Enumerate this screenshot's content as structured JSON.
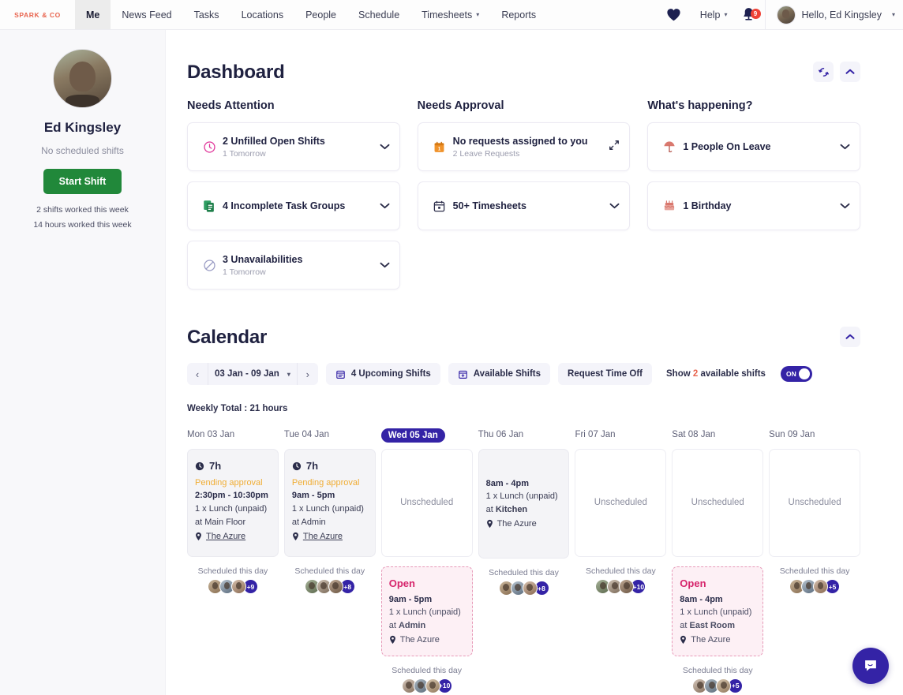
{
  "topnav": {
    "brand": "SPARK & CO",
    "items": [
      {
        "label": "Me",
        "active": true
      },
      {
        "label": "News Feed",
        "active": false
      },
      {
        "label": "Tasks",
        "active": false
      },
      {
        "label": "Locations",
        "active": false
      },
      {
        "label": "People",
        "active": false
      },
      {
        "label": "Schedule",
        "active": false
      },
      {
        "label": "Timesheets",
        "active": false,
        "caret": true
      },
      {
        "label": "Reports",
        "active": false
      }
    ],
    "help_label": "Help",
    "notification_count": "9",
    "user_label": "Hello, Ed Kingsley"
  },
  "sidebar": {
    "name": "Ed Kingsley",
    "status": "No scheduled shifts",
    "start_shift_label": "Start Shift",
    "stat_shifts": "2 shifts worked this week",
    "stat_hours": "14 hours worked this week"
  },
  "dashboard": {
    "title": "Dashboard",
    "columns": [
      {
        "title": "Needs Attention",
        "cards": [
          {
            "icon": "clock-alert-icon",
            "main": "2 Unfilled Open Shifts",
            "sub": "1 Tomorrow",
            "action": "chevron-down-icon"
          },
          {
            "icon": "task-groups-icon",
            "main": "4 Incomplete Task Groups",
            "sub": "",
            "action": "chevron-down-icon"
          },
          {
            "icon": "unavailability-icon",
            "main": "3 Unavailabilities",
            "sub": "1 Tomorrow",
            "action": "chevron-down-icon"
          }
        ]
      },
      {
        "title": "Needs Approval",
        "cards": [
          {
            "icon": "leave-request-icon",
            "main": "No requests assigned to you",
            "sub": "2 Leave Requests",
            "action": "expand-icon"
          },
          {
            "icon": "timesheet-icon",
            "main": "50+ Timesheets",
            "sub": "",
            "action": "chevron-down-icon"
          }
        ]
      },
      {
        "title": "What's happening?",
        "cards": [
          {
            "icon": "beach-umbrella-icon",
            "main": "1 People On Leave",
            "sub": "",
            "action": "chevron-down-icon"
          },
          {
            "icon": "birthday-cake-icon",
            "main": "1 Birthday",
            "sub": "",
            "action": "chevron-down-icon"
          }
        ]
      }
    ]
  },
  "calendar": {
    "title": "Calendar",
    "date_range": "03 Jan - 09 Jan",
    "upcoming_shifts_label": "4 Upcoming Shifts",
    "available_shifts_label": "Available Shifts",
    "request_time_off_label": "Request Time Off",
    "show_available_prefix": "Show",
    "show_available_count": "2",
    "show_available_suffix": "available shifts",
    "toggle_state": "ON",
    "weekly_total": "Weekly Total : 21 hours",
    "days": [
      {
        "name": "Mon 03 Jan",
        "today": false,
        "shift": {
          "type": "filled",
          "hours": "7h",
          "status": "Pending approval",
          "time": "2:30pm - 10:30pm",
          "break": "1 x Lunch (unpaid)",
          "area": "at Main Floor",
          "location": "The Azure"
        },
        "scheduled_label": "Scheduled this day",
        "more_count": "+9",
        "open_shift": null,
        "open_scheduled_label": null,
        "open_more_count": null
      },
      {
        "name": "Tue 04 Jan",
        "today": false,
        "shift": {
          "type": "filled",
          "hours": "7h",
          "status": "Pending approval",
          "time": "9am - 5pm",
          "break": "1 x Lunch (unpaid)",
          "area": "at Admin",
          "location": "The Azure"
        },
        "scheduled_label": "Scheduled this day",
        "more_count": "+8",
        "open_shift": null,
        "open_scheduled_label": null,
        "open_more_count": null
      },
      {
        "name": "Wed 05 Jan",
        "today": true,
        "shift": {
          "type": "empty",
          "empty_label": "Unscheduled"
        },
        "scheduled_label": null,
        "more_count": null,
        "open_shift": {
          "title": "Open",
          "time": "9am - 5pm",
          "break": "1 x Lunch (unpaid)",
          "area": "at Admin",
          "area_name": "Admin",
          "location": "The Azure"
        },
        "open_scheduled_label": "Scheduled this day",
        "open_more_count": "+10"
      },
      {
        "name": "Thu 06 Jan",
        "today": false,
        "shift": {
          "type": "filled",
          "hours": "",
          "status": "",
          "time": "8am - 4pm",
          "break": "1 x Lunch (unpaid)",
          "area": "at Kitchen",
          "area_name": "Kitchen",
          "location": "The Azure"
        },
        "scheduled_label": "Scheduled this day",
        "more_count": "+8",
        "open_shift": null,
        "open_scheduled_label": null,
        "open_more_count": null
      },
      {
        "name": "Fri 07 Jan",
        "today": false,
        "shift": {
          "type": "empty",
          "empty_label": "Unscheduled"
        },
        "scheduled_label": "Scheduled this day",
        "more_count": "+10",
        "open_shift": null,
        "open_scheduled_label": null,
        "open_more_count": null
      },
      {
        "name": "Sat 08 Jan",
        "today": false,
        "shift": {
          "type": "empty",
          "empty_label": "Unscheduled"
        },
        "scheduled_label": null,
        "more_count": null,
        "open_shift": {
          "title": "Open",
          "time": "8am - 4pm",
          "break": "1 x Lunch (unpaid)",
          "area": "at East Room",
          "area_name": "East Room",
          "location": "The Azure"
        },
        "open_scheduled_label": "Scheduled this day",
        "open_more_count": "+5"
      },
      {
        "name": "Sun 09 Jan",
        "today": false,
        "shift": {
          "type": "empty",
          "empty_label": "Unscheduled"
        },
        "scheduled_label": "Scheduled this day",
        "more_count": "+5",
        "open_shift": null,
        "open_scheduled_label": null,
        "open_more_count": null
      }
    ]
  },
  "colors": {
    "accent": "#3423a6",
    "brand": "#e8654f",
    "open_shift": "#d6246b",
    "pending": "#f0ad34",
    "start_shift": "#21883a",
    "badge": "#ef4136"
  }
}
